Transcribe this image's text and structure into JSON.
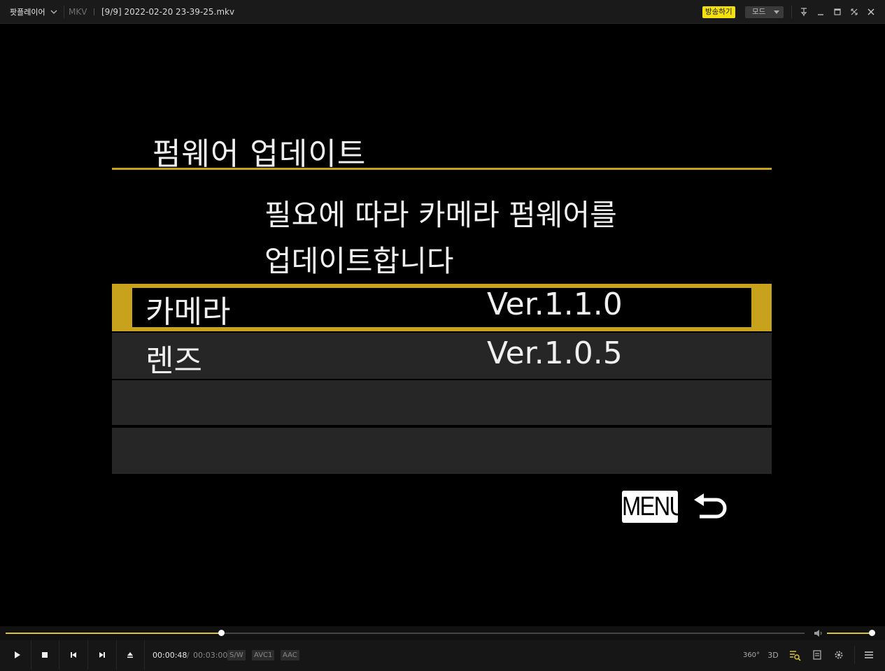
{
  "titlebar": {
    "app_name": "팟플레이어",
    "format": "MKV",
    "file_title": "[9/9]  2022-02-20  23-39-25.mkv",
    "broadcast_label": "방송하기",
    "mode_label": "모드"
  },
  "video": {
    "menu_title": "펌웨어 업데이트",
    "description_line1": "필요에 따라 카메라 펌웨어를",
    "description_line2": "업데이트합니다",
    "rows": [
      {
        "label": "카메라",
        "version": "Ver.1.1.0",
        "selected": true
      },
      {
        "label": "렌즈",
        "version": "Ver.1.0.5",
        "selected": false
      }
    ],
    "menu_button": "MENU",
    "accent_color": "#c9a21d"
  },
  "playback": {
    "current_time": "00:00:48",
    "separator": "/",
    "total_time": "00:03:00",
    "progress_fraction": 0.27,
    "volume_fraction": 1.0,
    "tags": [
      "S/W",
      "AVC1",
      "AAC"
    ],
    "right_buttons": {
      "vr": "360°",
      "three_d": "3D"
    }
  }
}
